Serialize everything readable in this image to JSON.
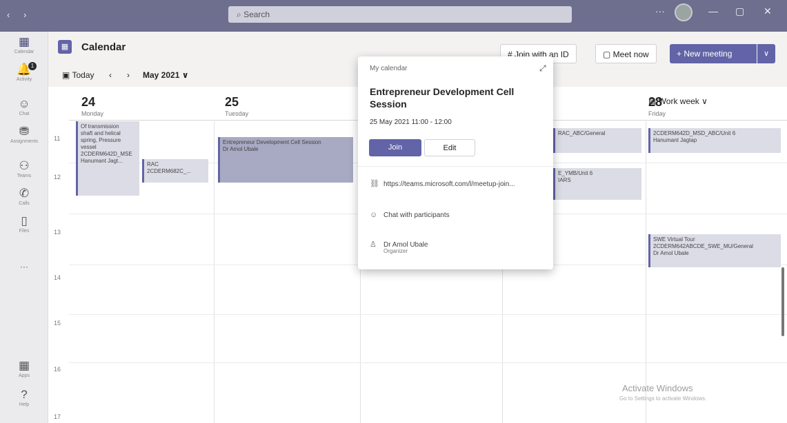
{
  "titlebar": {
    "nav": "‹  ›",
    "search_placeholder": "Search",
    "more": "···",
    "minimize": "—",
    "restore": "▢",
    "close": "✕"
  },
  "rail": [
    {
      "icon": "▦",
      "label": "Calendar"
    },
    {
      "icon": "🔔",
      "label": "Activity",
      "badge": "1"
    },
    {
      "icon": "☺",
      "label": "Chat"
    },
    {
      "icon": "⛃",
      "label": "Assignments"
    },
    {
      "icon": "⚇",
      "label": "Teams"
    },
    {
      "icon": "✆",
      "label": "Calls"
    },
    {
      "icon": "▯",
      "label": "Files"
    },
    {
      "icon": "···",
      "label": ""
    },
    {
      "icon": "▦",
      "label": "Apps"
    },
    {
      "icon": "?",
      "label": "Help"
    }
  ],
  "header": {
    "title": "Calendar",
    "join_id": "# Join with an ID",
    "meet_now": "▢ Meet now",
    "new_meeting": "+ New meeting",
    "new_meeting_dd": "∨",
    "today": "Today",
    "prev": "‹",
    "next": "›",
    "month": "May 2021 ∨",
    "view": "Work week ∨"
  },
  "days": [
    {
      "num": "24",
      "name": "Monday"
    },
    {
      "num": "25",
      "name": "Tuesday"
    },
    {
      "num": "28",
      "name": "Friday"
    }
  ],
  "hours": [
    "11",
    "12",
    "13",
    "14",
    "15",
    "16",
    "17"
  ],
  "events": {
    "mon1_l1": "Of transmission",
    "mon1_l2": "shaft and helical",
    "mon1_l3": "spring, Pressure",
    "mon1_l4": "vessel",
    "mon1_l5": "2CDERM642D_MSE",
    "mon1_l6": "Hanumant Jagt...",
    "mon2_l1": "RAC",
    "mon2_l2": "2CDERM682C_...",
    "tue_title": "Entrepreneur Development Cell Session",
    "tue_org": "Dr Amol Ubale",
    "thu1": "RAC_ABC/General",
    "thu2_l1": "E_YMB/Unit 6",
    "thu2_l2": "IARS",
    "fri1_l1": "2CDERM642D_MSD_ABC/Unit 6",
    "fri1_l2": "Hanumant Jagtap",
    "fri2_l1": "SWE Virtual Tour",
    "fri2_l2": "2CDERM642ABCDE_SWE_MU/General",
    "fri2_l3": "Dr Amol Ubale"
  },
  "popup": {
    "calendar_label": "My calendar",
    "title": "Entrepreneur Development Cell Session",
    "time": "25 May 2021 11:00 - 12:00",
    "join": "Join",
    "edit": "Edit",
    "link": "https://teams.microsoft.com/l/meetup-join...",
    "chat": "Chat with participants",
    "organizer": "Dr Amol Ubale",
    "organizer_role": "Organizer"
  },
  "watermark": {
    "line1": "Activate Windows",
    "line2": "Go to Settings to activate Windows."
  }
}
